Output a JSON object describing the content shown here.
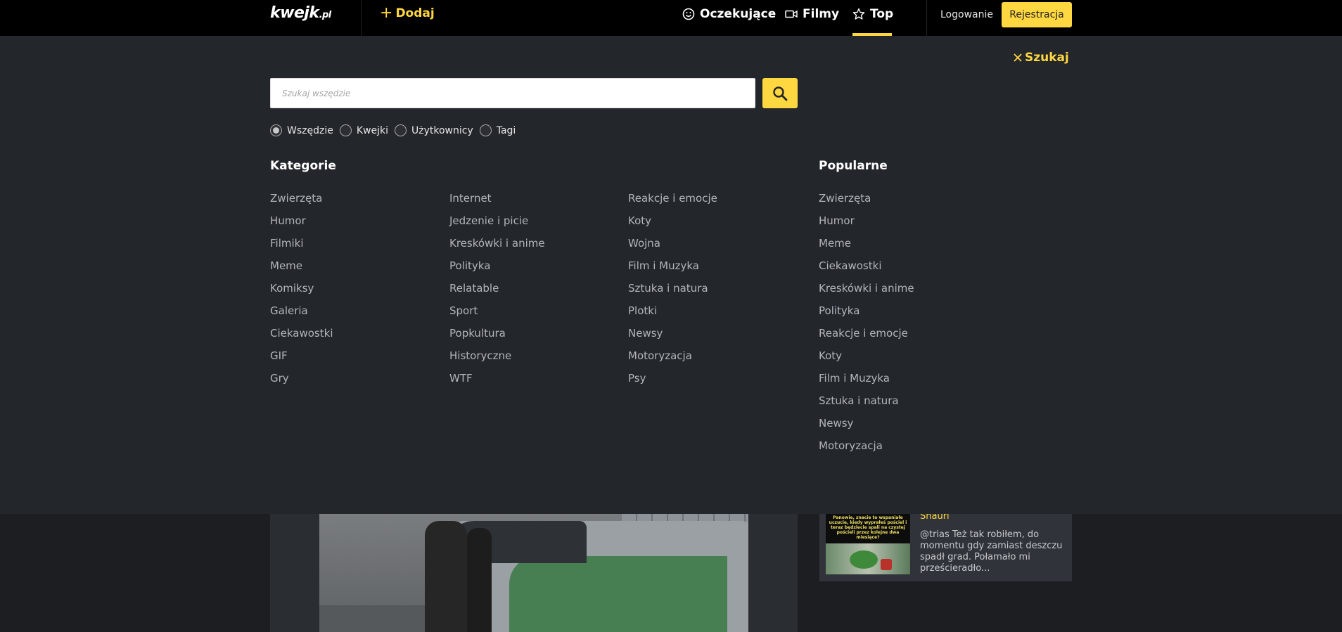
{
  "header": {
    "logo_main": "kwejk",
    "logo_suffix": ".pl",
    "add_label": "Dodaj",
    "nav": [
      {
        "label": "Oczekujące",
        "icon": "smiley-icon"
      },
      {
        "label": "Filmy",
        "icon": "video-camera-icon"
      },
      {
        "label": "Top",
        "icon": "star-icon",
        "active": true
      }
    ],
    "login_label": "Logowanie",
    "register_label": "Rejestracja",
    "accent_color": "#ffd740"
  },
  "search": {
    "close_label": "Szukaj",
    "placeholder": "Szukaj wszędzie",
    "value": "",
    "scopes": [
      {
        "label": "Wszędzie",
        "checked": true
      },
      {
        "label": "Kwejki",
        "checked": false
      },
      {
        "label": "Użytkownicy",
        "checked": false
      },
      {
        "label": "Tagi",
        "checked": false
      }
    ]
  },
  "categories": {
    "title": "Kategorie",
    "columns": [
      [
        "Zwierzęta",
        "Humor",
        "Filmiki",
        "Meme",
        "Komiksy",
        "Galeria",
        "Ciekawostki",
        "GIF",
        "Gry"
      ],
      [
        "Internet",
        "Jedzenie i picie",
        "Kreskówki i anime",
        "Polityka",
        "Relatable",
        "Sport",
        "Popkultura",
        "Historyczne",
        "WTF"
      ],
      [
        "Reakcje i emocje",
        "Koty",
        "Wojna",
        "Film i Muzyka",
        "Sztuka i natura",
        "Plotki",
        "Newsy",
        "Motoryzacja",
        "Psy"
      ]
    ]
  },
  "popular": {
    "title": "Popularne",
    "items": [
      "Zwierzęta",
      "Humor",
      "Meme",
      "Ciekawostki",
      "Kreskówki i anime",
      "Polityka",
      "Reakcje i emocje",
      "Koty",
      "Film i Muzyka",
      "Sztuka i natura",
      "Newsy",
      "Motoryzacja"
    ]
  },
  "comment": {
    "thumb_text": "Panowie, znacie to wspaniałe uczucie, kiedy wyprałeś pościel i teraz będziecie spali na czystej pościeli przez kolejne dwa miesiące?",
    "user": "Shauri",
    "text": "@trias Też tak robiłem, do momentu gdy zamiast deszczu spadł grad. Połamało mi prześcieradło..."
  }
}
